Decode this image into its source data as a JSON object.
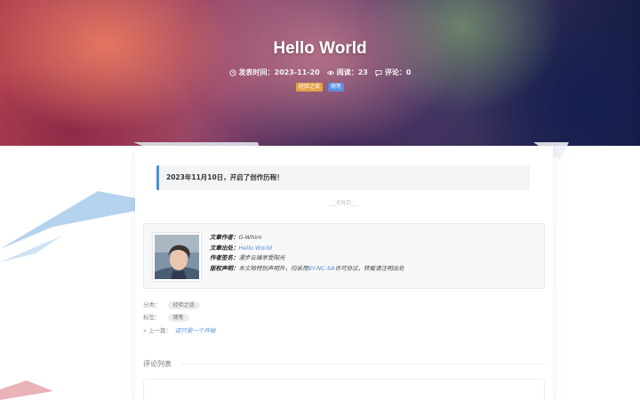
{
  "post": {
    "title": "Hello World",
    "meta": {
      "published": "发表时间：2023-11-20",
      "views": "阅读：23",
      "comments": "评论：0"
    },
    "category_badge": "经验之谈",
    "tag_badge": "随笔"
  },
  "content": {
    "quote": "2023年11月10日，开启了创作历程！",
    "end_mark": "__END__"
  },
  "copyright": {
    "author_label": "文章作者：",
    "author_value": "G-Whim",
    "source_label": "文章出处：",
    "source_value": "Hello World",
    "motto_label": "作者签名：",
    "motto_value": "漫步云端享受阳光",
    "license_label": "版权声明：",
    "license_prefix": "本文除特别声明外，均采用",
    "license_link": "BY-NC-SA",
    "license_suffix": "许可协议，转载请注明出处"
  },
  "taxonomy": {
    "category_label": "分类：",
    "category_value": "经验之谈",
    "tags_label": "标签：",
    "tag_value": "随笔",
    "prev_label": "« 上一篇：",
    "prev_value": "这只是一个开始"
  },
  "comments": {
    "title": "评论列表"
  },
  "icons": {
    "clock": "clock-icon",
    "eye": "eye-icon",
    "comment": "comment-icon"
  },
  "colors": {
    "accent": "#4d8fdc",
    "category_badge": "#e2a44a",
    "tag_badge": "#5b8de0"
  }
}
